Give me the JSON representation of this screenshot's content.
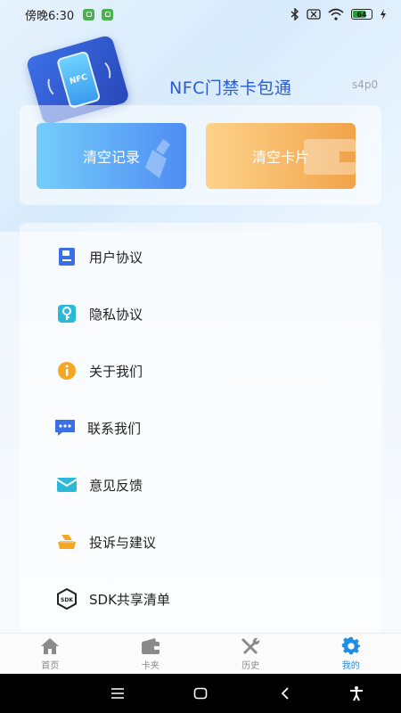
{
  "status_bar": {
    "time": "傍晚6:30",
    "battery": "64"
  },
  "header": {
    "logo_text": "NFC",
    "title": "NFC门禁卡包通",
    "version": "s4p0"
  },
  "actions": {
    "clear_records": "清空记录",
    "clear_cards": "清空卡片"
  },
  "menu": {
    "items": [
      {
        "label": "用户协议",
        "icon": "document-icon",
        "color": "#3a6fe8"
      },
      {
        "label": "隐私协议",
        "icon": "key-icon",
        "color": "#2cb8d8"
      },
      {
        "label": "关于我们",
        "icon": "info-icon",
        "color": "#f5a623"
      },
      {
        "label": "联系我们",
        "icon": "chat-icon",
        "color": "#3a6fe8"
      },
      {
        "label": "意见反馈",
        "icon": "mail-icon",
        "color": "#2cb8d8"
      },
      {
        "label": "投诉与建议",
        "icon": "complaint-icon",
        "color": "#f5a623"
      },
      {
        "label": "SDK共享清单",
        "icon": "sdk-icon",
        "color": "#222222"
      }
    ]
  },
  "bottom_nav": {
    "items": [
      {
        "label": "首页",
        "icon": "home-icon"
      },
      {
        "label": "卡夹",
        "icon": "wallet-icon"
      },
      {
        "label": "历史",
        "icon": "tools-icon"
      },
      {
        "label": "我的",
        "icon": "gear-icon",
        "active": true
      }
    ]
  },
  "colors": {
    "accent": "#1e8fe6",
    "title": "#2a5bd6"
  }
}
